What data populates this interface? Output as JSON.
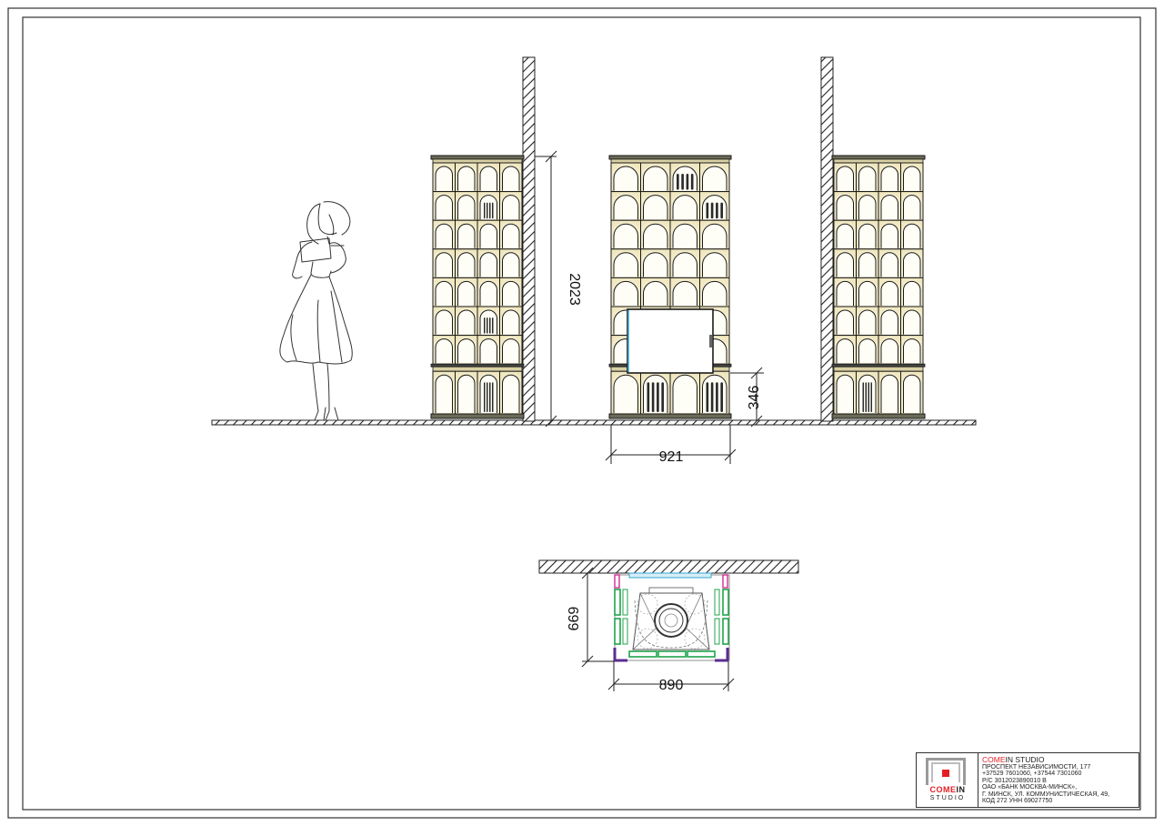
{
  "drawing": {
    "elevation": {
      "dimensions": {
        "height_total": "2023",
        "base_height": "346",
        "width": "921"
      }
    },
    "plan": {
      "dimensions": {
        "depth": "699",
        "width": "890"
      }
    }
  },
  "title_block": {
    "company_prefix": "COME",
    "company_suffix": "IN STUDIO",
    "logo_line1_red": "COME",
    "logo_line1_rest": "IN",
    "logo_line2": "STUDIO",
    "lines": [
      "ПРОСПЕКТ  НЕЗАВИСИМОСТИ,  177",
      "+37529 7601060, +37544 7301060",
      "Р/С  3012023890010 В",
      "ОАО  «БАНК МОСКВА-МИНСК»,",
      "Г. МИНСК, УЛ. КОММУНИСТИЧЕСКАЯ, 49,",
      "КОД 272 УНН 69027750"
    ]
  },
  "colors": {
    "tile_fill": "#f3eccb",
    "tile_glow": "#fffdf2",
    "outline": "#1a1a1a",
    "plan_green": "#1fa34a",
    "plan_purple": "#5b2d90",
    "plan_magenta": "#d43c9c",
    "plan_cyan": "#35a7d6",
    "brand_red": "#e31e24"
  },
  "icons": {
    "logo": "comein-studio-logo",
    "figure": "woman-scale-figure"
  }
}
